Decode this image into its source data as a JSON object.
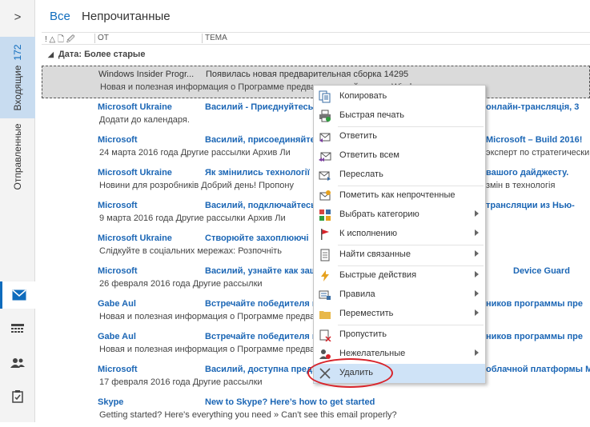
{
  "filters": {
    "all": "Все",
    "unread": "Непрочитанные"
  },
  "rail": {
    "inbox_label": "Входящие",
    "inbox_count": "172",
    "sent_label": "Отправленные"
  },
  "columns": {
    "icons": "! △ 🗋 🖉",
    "from": "ОТ",
    "subject": "ТЕМА"
  },
  "group": {
    "label": "Дата: Более старые"
  },
  "rows": [
    {
      "from": "Windows Insider Progr...",
      "subject": "Появилась новая предварительная сборка 14295",
      "preview": "Новая и полезная информация о Программе предварительной оценки Windows",
      "subject_right": "",
      "preview_right": ""
    },
    {
      "from": "Microsoft Ukraine",
      "subject": "Василий - Приєднуйтесь",
      "preview": "Додати до календаря.",
      "subject_right": "онлайн-трансляція, 3",
      "preview_right": ""
    },
    {
      "from": "Microsoft",
      "subject": "Василий, присоединяйтесь",
      "preview": "24 марта 2016 года  Другие рассылки      Архив      Ли",
      "subject_right": "Microsoft – Build 2016!",
      "preview_right": "эксперт по стратегическим"
    },
    {
      "from": "Microsoft Ukraine",
      "subject": "Як змінились технології",
      "preview": "Новини для розробників  Добрий день!  Пропону",
      "subject_right": "вашого дайджесту.",
      "preview_right": "змін в технологія"
    },
    {
      "from": "Microsoft",
      "subject": "Василий, подключайтесь",
      "preview": "9 марта 2016 года  Другие рассылки      Архив      Ли",
      "subject_right": "трансляции из Нью-",
      "preview_right": ""
    },
    {
      "from": "Microsoft Ukraine",
      "subject": "Створюйте захоплюючі",
      "preview": "Слідкуйте в соціальних мережах:  Розпочніть",
      "subject_right": "",
      "preview_right": ""
    },
    {
      "from": "Microsoft",
      "subject": "Василий, узнайте как защ",
      "preview": "26 февраля 2016 года  Другие рассылки",
      "subject_right": "Device Guard",
      "preview_right": ""
    },
    {
      "from": "Gabe Aul",
      "subject": "Встречайте победителя из",
      "preview": "Новая и полезная информация о Программе предварительной",
      "subject_right": "ников программы пре",
      "preview_right": ""
    },
    {
      "from": "Gabe Aul",
      "subject": "Встречайте победителя из",
      "preview": "Новая и полезная информация о Программе предварительной",
      "subject_right": "ников программы пре",
      "preview_right": ""
    },
    {
      "from": "Microsoft",
      "subject": "Василий, доступна предв",
      "preview": "17 февраля 2016 года  Другие рассылки",
      "subject_right": "облачной платформы M",
      "preview_right": ""
    },
    {
      "from": "Skype",
      "subject": "New to Skype? Here’s how to get started",
      "preview": "Getting started? Here's everything you need »  Can't see this email properly?",
      "subject_right": "",
      "preview_right": ""
    }
  ],
  "menu": {
    "copy": "Копировать",
    "quick_print": "Быстрая печать",
    "reply": "Ответить",
    "reply_all": "Ответить всем",
    "forward": "Переслать",
    "mark_unread": "Пометить как непрочтенные",
    "categorize": "Выбрать категорию",
    "follow_up": "К исполнению",
    "find_related": "Найти связанные",
    "quick_steps": "Быстрые действия",
    "rules": "Правила",
    "move": "Переместить",
    "ignore": "Пропустить",
    "junk": "Нежелательные",
    "delete": "Удалить"
  },
  "colors": {
    "accent": "#0f6cbd",
    "highlight": "#cfe3f7",
    "annotation_ring": "#d8232a"
  }
}
